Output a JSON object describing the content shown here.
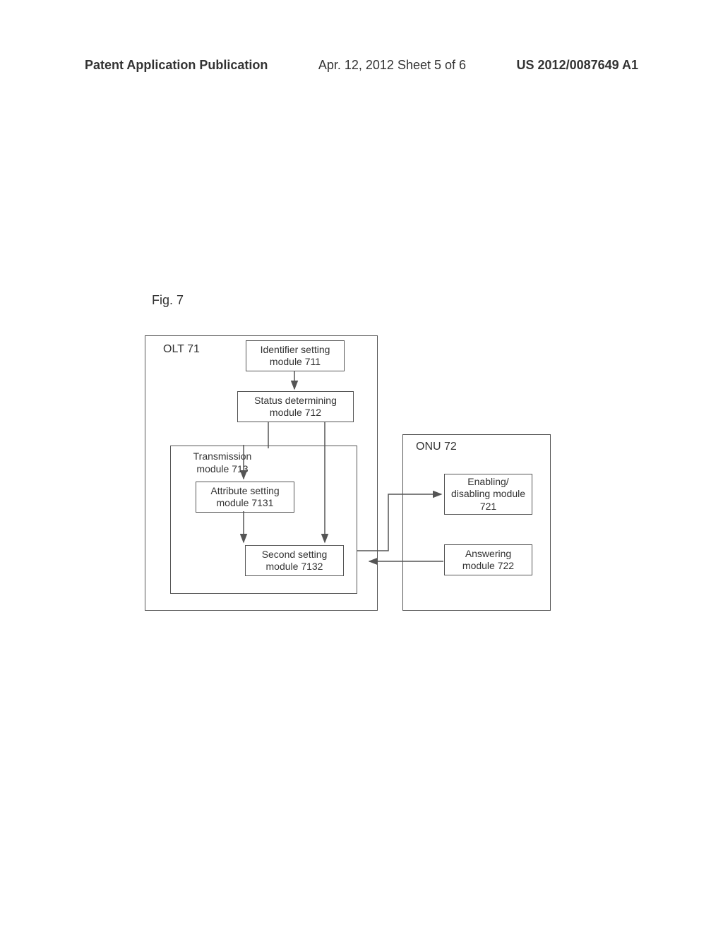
{
  "header": {
    "left": "Patent Application Publication",
    "center": "Apr. 12, 2012  Sheet 5 of 6",
    "right": "US 2012/0087649 A1"
  },
  "figure_label": "Fig. 7",
  "olt": {
    "label": "OLT 71",
    "modules": {
      "identifier": "Identifier setting module 711",
      "status": "Status determining module 712",
      "transmission_label": "Transmission module 713",
      "attribute": "Attribute setting module 7131",
      "second": "Second setting module 7132"
    }
  },
  "onu": {
    "label": "ONU 72",
    "modules": {
      "enabling": "Enabling/ disabling module 721",
      "answering": "Answering module 722"
    }
  }
}
